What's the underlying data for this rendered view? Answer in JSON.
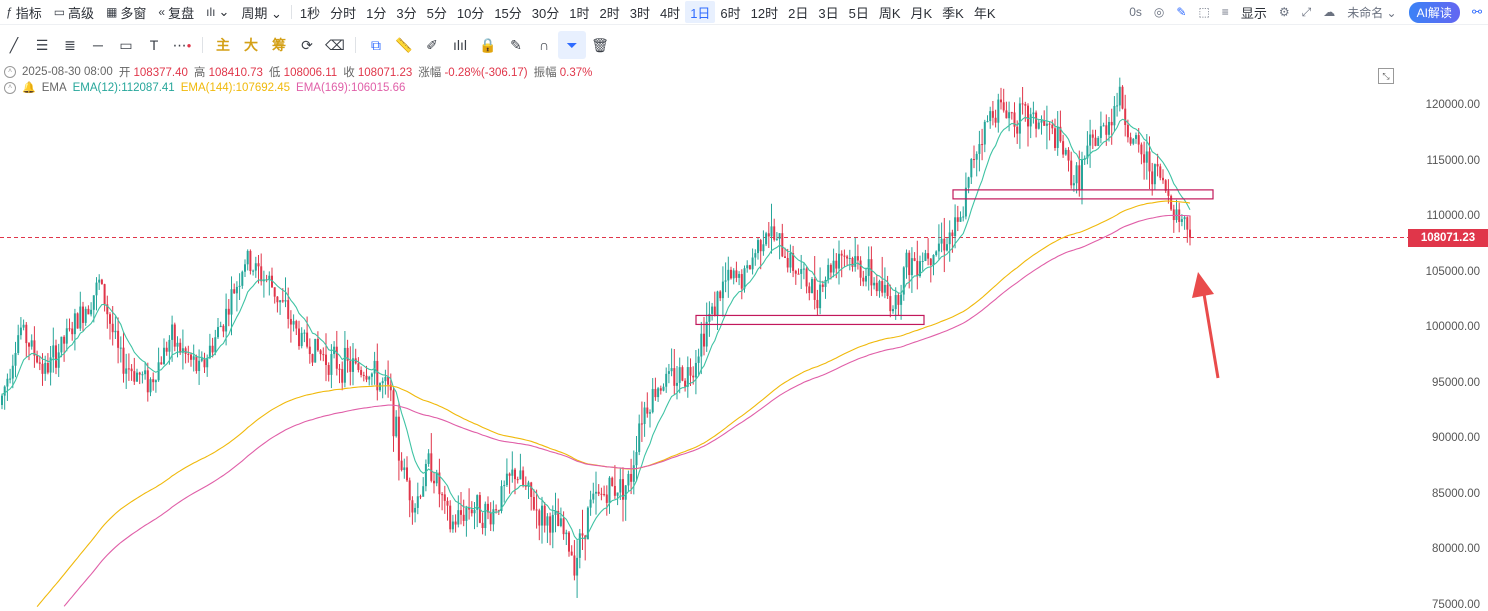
{
  "toolbar": {
    "items": [
      {
        "icon": "indicator-icon",
        "label": "指标"
      },
      {
        "icon": "advanced-icon",
        "label": "高级"
      },
      {
        "icon": "multi-window-icon",
        "label": "多窗"
      },
      {
        "icon": "replay-icon",
        "label": "复盘"
      },
      {
        "icon": "chart-type-icon",
        "label": "⌄"
      },
      {
        "icon": "",
        "label": "周期 ⌄"
      }
    ],
    "timeframes": [
      "1秒",
      "分时",
      "1分",
      "3分",
      "5分",
      "10分",
      "15分",
      "30分",
      "1时",
      "2时",
      "3时",
      "4时",
      "1日",
      "6时",
      "12时",
      "2日",
      "3日",
      "5日",
      "周K",
      "月K",
      "季K",
      "年K"
    ],
    "active_timeframe": "1日",
    "right": {
      "countdown": "0s",
      "display": "显示",
      "layout_name": "未命名 ⌄",
      "ai_button": "AI解读"
    }
  },
  "drawbar": {
    "tools": [
      "line-tool-icon",
      "parallel-tool-icon",
      "fib-tool-icon",
      "hline-tool-icon",
      "rect-tool-icon",
      "text-tool-icon",
      "more-tool-icon"
    ],
    "main_label": "主",
    "big_label": "大",
    "chip_label": "筹"
  },
  "info": {
    "datetime": "2025-08-30 08:00",
    "open_label": "开",
    "open": "108377.40",
    "high_label": "高",
    "high": "108410.73",
    "low_label": "低",
    "low": "108006.11",
    "close_label": "收",
    "close": "108071.23",
    "change_label": "涨幅",
    "change": "-0.28%(-306.17)",
    "amp_label": "振幅",
    "amp": "0.37%",
    "ema_title": "EMA",
    "ema12": "EMA(12):112087.41",
    "ema144": "EMA(144):107692.45",
    "ema169": "EMA(169):106015.66"
  },
  "axis": {
    "labels": [
      "120000.00",
      "115000.00",
      "110000.00",
      "105000.00",
      "100000.00",
      "95000.00",
      "90000.00",
      "85000.00",
      "80000.00",
      "75000.00"
    ],
    "values": [
      120000,
      115000,
      110000,
      105000,
      100000,
      95000,
      90000,
      85000,
      80000,
      75000
    ],
    "current_price": "108071.23",
    "current_value": 108071.23
  },
  "colors": {
    "up": "#26a69a",
    "down": "#e0364a",
    "ema12": "#3fc3a4",
    "ema144": "#f0b90b",
    "ema169": "#e05fa8",
    "box": "#c2185b",
    "arrow": "#e94b4b"
  },
  "chart_data": {
    "type": "candlestick",
    "ylim": [
      75000,
      124000
    ],
    "support_zones": [
      {
        "x_start": 270,
        "x_end": 333,
        "price": 100700
      },
      {
        "x_start": 351,
        "x_end": 434,
        "price": 112000
      }
    ],
    "candle_count": 440
  }
}
